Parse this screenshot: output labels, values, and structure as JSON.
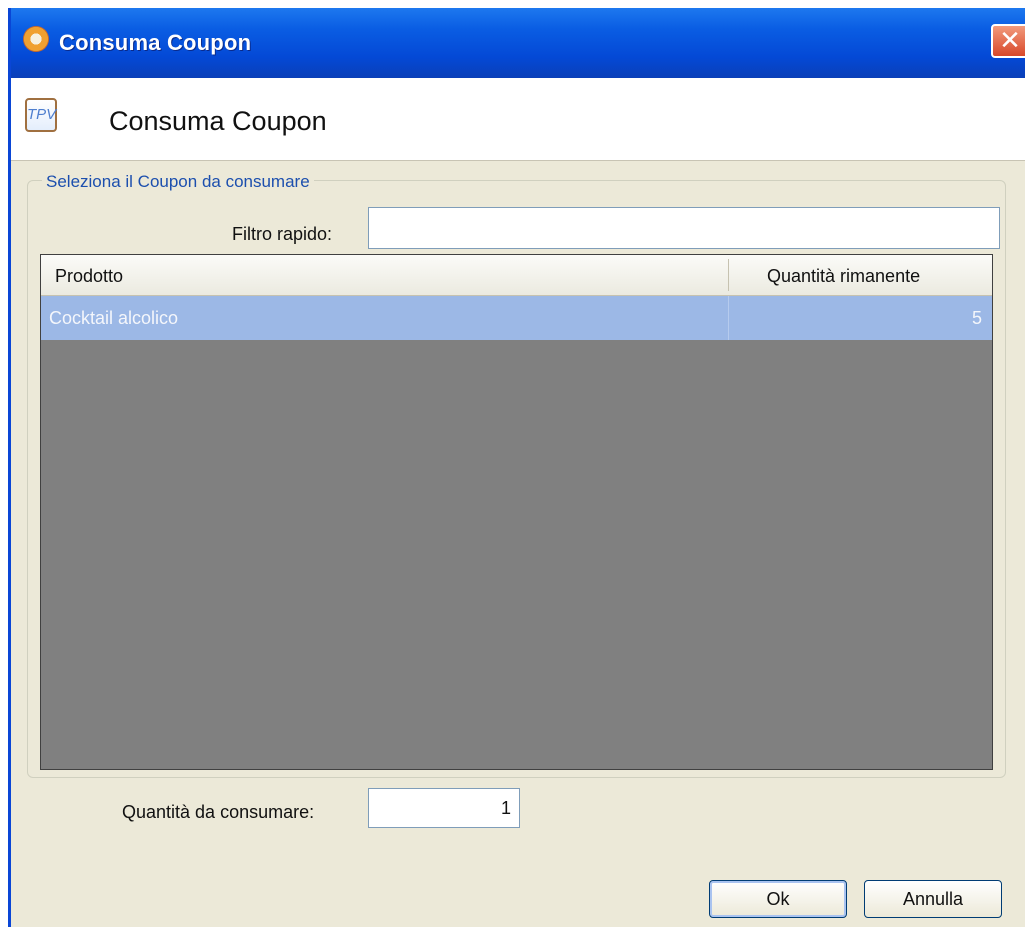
{
  "window": {
    "title": "Consuma Coupon",
    "close_glyph": "✕"
  },
  "header": {
    "icon_text": "TPV",
    "title": "Consuma Coupon"
  },
  "group": {
    "legend": "Seleziona il Coupon da consumare"
  },
  "filter": {
    "label": "Filtro rapido:",
    "value": "",
    "placeholder": ""
  },
  "grid": {
    "columns": [
      "Prodotto",
      "Quantità rimanente"
    ],
    "rows": [
      {
        "prodotto": "Cocktail alcolico",
        "quantita": "5",
        "selected": true
      }
    ]
  },
  "quantity": {
    "label": "Quantità da consumare:",
    "value": "1"
  },
  "buttons": {
    "ok": "Ok",
    "cancel": "Annulla"
  },
  "icons": {
    "title_icon": "app-icon",
    "close_icon": "close-icon",
    "header_icon": "tpv-icon"
  },
  "colors": {
    "titlebar": "#0a5de3",
    "selection": "#9cb8e6",
    "grid_background": "#808080",
    "legend_text": "#1c4fae"
  }
}
